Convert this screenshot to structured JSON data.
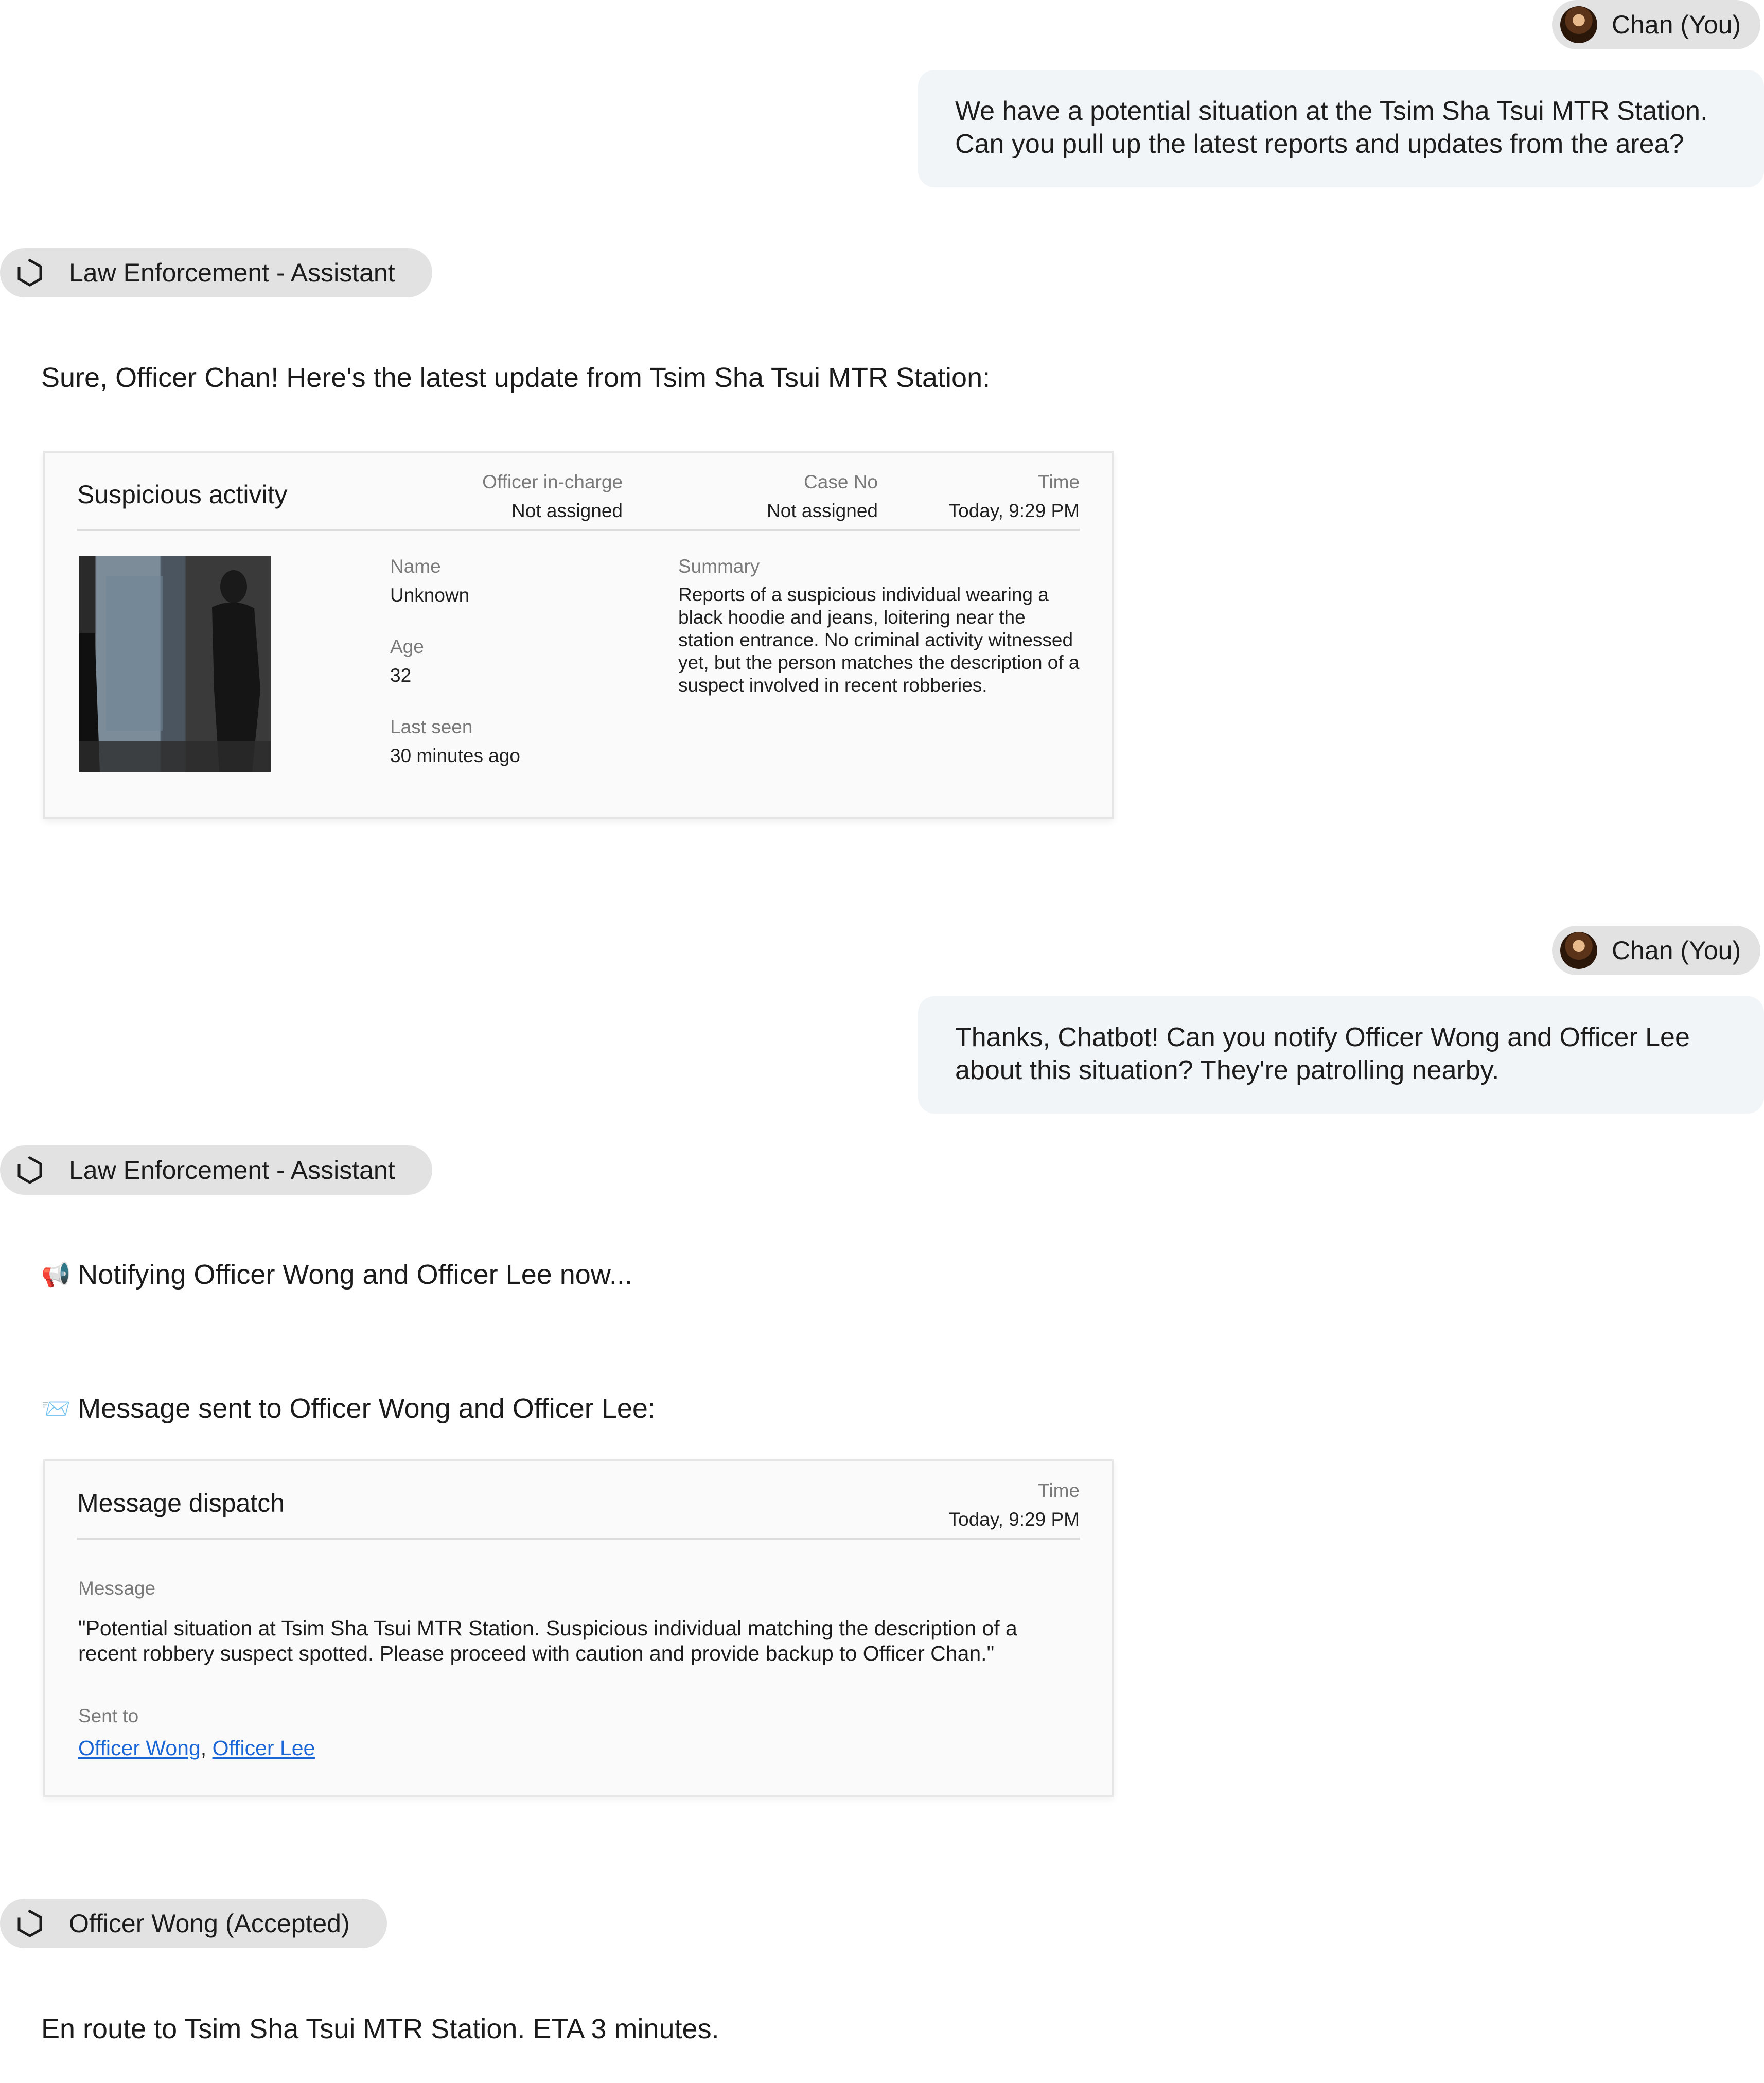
{
  "conversation": {
    "user_name": "Chan (You)",
    "assistant_name": "Law Enforcement - Assistant",
    "msg1": {
      "line1": "We have a potential situation at the Tsim Sha Tsui MTR Station.",
      "line2": "Can you pull up the latest reports and updates from the area?"
    },
    "reply1": "Sure, Officer Chan! Here's the latest update from Tsim Sha Tsui MTR Station:",
    "msg2": {
      "line1": "Thanks, Chatbot! Can you notify Officer Wong and Officer Lee",
      "line2": "about this situation? They're patrolling nearby."
    },
    "reply2a": {
      "icon": "megaphone-icon",
      "glyph": "📢",
      "text": "Notifying Officer Wong and Officer Lee now..."
    },
    "reply2b": {
      "icon": "envelope-icon",
      "glyph": "📨",
      "text": "Message sent to Officer Wong and Officer Lee:"
    },
    "officer_pill": "Officer Wong (Accepted)",
    "officer_reply": "En route to Tsim Sha Tsui MTR Station. ETA 3 minutes."
  },
  "incident_card": {
    "title": "Suspicious activity",
    "officer_label": "Officer in-charge",
    "officer_value": "Not assigned",
    "case_label": "Case No",
    "case_value": "Not assigned",
    "time_label": "Time",
    "time_value": "Today, 9:29 PM",
    "name_label": "Name",
    "name_value": "Unknown",
    "age_label": "Age",
    "age_value": "32",
    "seen_label": "Last seen",
    "seen_value": "30 minutes ago",
    "summary_label": "Summary",
    "summary_value": "Reports of a suspicious individual wearing a black hoodie and jeans, loitering near the station entrance. No criminal activity witnessed yet, but the person matches the description of a suspect involved in recent robberies."
  },
  "dispatch_card": {
    "title": "Message dispatch",
    "time_label": "Time",
    "time_value": "Today, 9:29 PM",
    "message_label": "Message",
    "message_value": "\"Potential situation at Tsim Sha Tsui MTR Station. Suspicious individual matching the description of a recent robbery suspect spotted. Please proceed with caution and provide backup to Officer Chan.\"",
    "sent_label": "Sent to",
    "recipients": [
      "Officer Wong",
      "Officer Lee"
    ],
    "separator": ", "
  },
  "colors": {
    "pill_bg": "#e2e2e2",
    "bubble_bg": "#f2f5f8",
    "link": "#1a66d6"
  }
}
